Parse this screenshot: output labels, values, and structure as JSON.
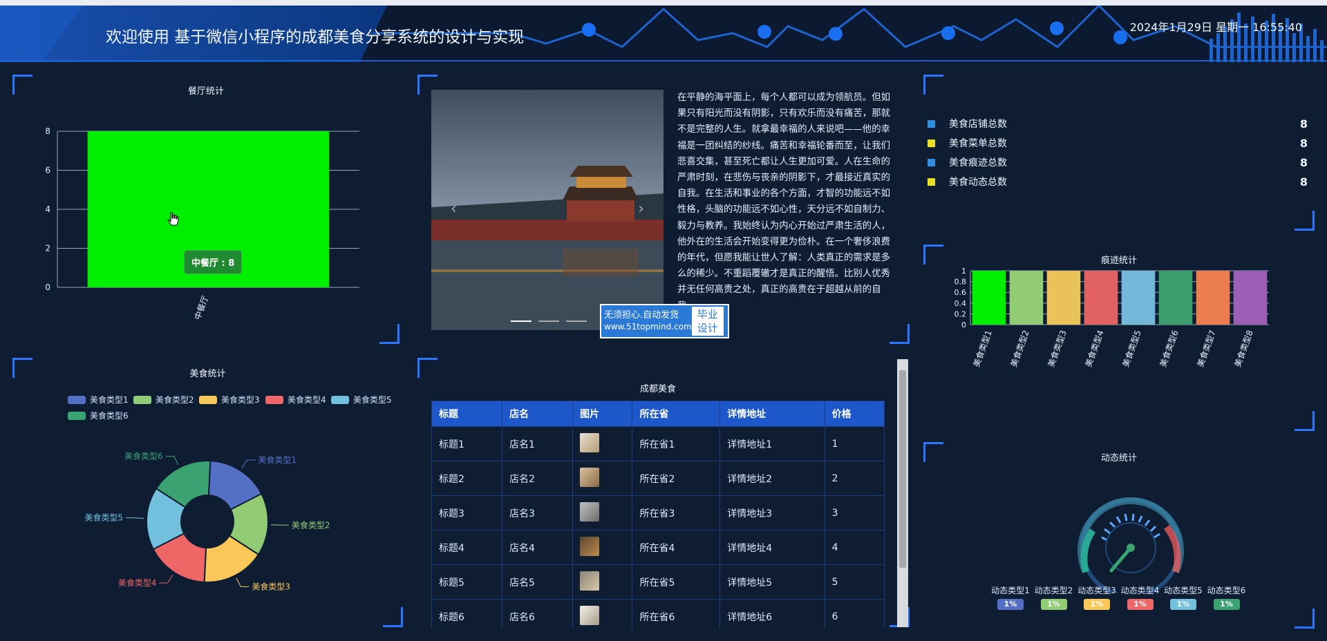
{
  "header": {
    "title": "欢迎使用 基于微信小程序的成都美食分享系统的设计与实现",
    "datetime": "2024年1月29日 星期一 16:55:40"
  },
  "restaurant_panel": {
    "title": "餐厅统计",
    "tooltip": "中餐厅 : 8",
    "chart_data": {
      "type": "bar",
      "categories": [
        "中餐厅"
      ],
      "values": [
        8
      ],
      "ylim": [
        0,
        8
      ],
      "yticks": [
        0,
        2,
        4,
        6,
        8
      ],
      "color": "#00ee00"
    }
  },
  "food_panel": {
    "title": "美食统计",
    "chart_data": {
      "type": "pie",
      "categories": [
        "美食类型1",
        "美食类型2",
        "美食类型3",
        "美食类型4",
        "美食类型5",
        "美食类型6"
      ],
      "values": [
        1,
        1,
        1,
        1,
        1,
        1
      ],
      "colors": [
        "#5470c6",
        "#91cc75",
        "#fac858",
        "#ee6666",
        "#73c0de",
        "#3ba272"
      ]
    }
  },
  "carousel": {
    "paragraph": "在平静的海平面上，每个人都可以成为领航员。但如果只有阳光而没有阴影，只有欢乐而没有痛苦，那就不是完整的人生。就拿最幸福的人来说吧——他的幸福是一团纠结的纱线。痛苦和幸福轮番而至，让我们悲喜交集，甚至死亡都让人生更加可爱。人在生命的严肃时刻，在悲伤与丧亲的阴影下，才最接近真实的自我。在生活和事业的各个方面，才智的功能远不如性格，头脑的功能远不如心性，天分远不如自制力、毅力与教养。我始终认为内心开始过严肃生活的人，他外在的生活会开始变得更为俭朴。在一个奢侈浪费的年代，但愿我能让世人了解：人类真正的需求是多么的稀少。不重蹈覆辙才是真正的醒悟。比别人优秀并无任何高贵之处，真正的高贵在于超越从前的自我。",
    "prev_icon": "‹",
    "next_icon": "›"
  },
  "watermark": {
    "line1": "无须担心.自动发货",
    "line2": "www.51topmind.com",
    "right1": "毕业",
    "right2": "设计"
  },
  "table_panel": {
    "title": "成都美食",
    "columns": [
      "标题",
      "店名",
      "图片",
      "所在省",
      "详情地址",
      "价格"
    ],
    "rows": [
      {
        "title": "标题1",
        "shop": "店名1",
        "province": "所在省1",
        "address": "详情地址1",
        "price": "1"
      },
      {
        "title": "标题2",
        "shop": "店名2",
        "province": "所在省2",
        "address": "详情地址2",
        "price": "2"
      },
      {
        "title": "标题3",
        "shop": "店名3",
        "province": "所在省3",
        "address": "详情地址3",
        "price": "3"
      },
      {
        "title": "标题4",
        "shop": "店名4",
        "province": "所在省4",
        "address": "详情地址4",
        "price": "4"
      },
      {
        "title": "标题5",
        "shop": "店名5",
        "province": "所在省5",
        "address": "详情地址5",
        "price": "5"
      },
      {
        "title": "标题6",
        "shop": "店名6",
        "province": "所在省6",
        "address": "详情地址6",
        "price": "6"
      }
    ]
  },
  "stats_panel": {
    "items": [
      {
        "label": "美食店铺总数",
        "value": "8",
        "color": "#2f8fe0"
      },
      {
        "label": "美食菜单总数",
        "value": "8",
        "color": "#e8e020"
      },
      {
        "label": "美食痕迹总数",
        "value": "8",
        "color": "#2f8fe0"
      },
      {
        "label": "美食动态总数",
        "value": "8",
        "color": "#e8e020"
      }
    ]
  },
  "trace_panel": {
    "title": "痕迹统计",
    "chart_data": {
      "type": "bar",
      "categories": [
        "美食类型1",
        "美食类型2",
        "美食类型3",
        "美食类型4",
        "美食类型5",
        "美食类型6",
        "美食类型7",
        "美食类型8"
      ],
      "values": [
        1,
        1,
        1,
        1,
        1,
        1,
        1,
        1
      ],
      "ylim": [
        0,
        1
      ],
      "yticks": [
        0,
        0.2,
        0.4,
        0.6,
        0.8,
        1
      ],
      "colors": [
        "#00ee00",
        "#91cc75",
        "#e9c25a",
        "#e26262",
        "#73b8d8",
        "#3b9e6c",
        "#ec7d4e",
        "#9b5fb5"
      ]
    }
  },
  "dynamic_panel": {
    "title": "动态统计",
    "chart_data": {
      "type": "gauge",
      "categories": [
        "动态类型1",
        "动态类型2",
        "动态类型3",
        "动态类型4",
        "动态类型5",
        "动态类型6"
      ],
      "values": [
        1,
        1,
        1,
        1,
        1,
        1
      ],
      "value_labels": [
        "1%",
        "1%",
        "1%",
        "1%",
        "1%",
        "1%"
      ],
      "colors": [
        "#5470c6",
        "#91cc75",
        "#fac858",
        "#ee6666",
        "#73c0de",
        "#3ba272"
      ]
    }
  }
}
